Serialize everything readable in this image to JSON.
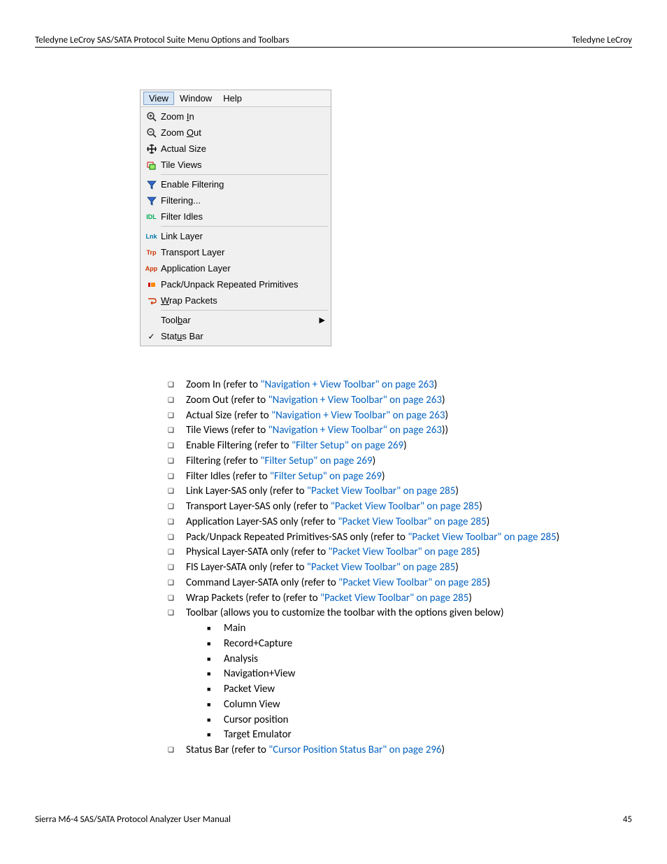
{
  "header": {
    "left": "Teledyne LeCroy SAS/SATA Protocol Suite Menu Options and Toolbars",
    "right": "Teledyne LeCroy"
  },
  "menubar": {
    "view": "View",
    "window": "Window",
    "help": "Help"
  },
  "menu": {
    "zoom_in": "Zoom In",
    "zoom_out": "Zoom Out",
    "actual_size": "Actual Size",
    "tile_views": "Tile Views",
    "enable_filtering": "Enable Filtering",
    "filtering": "Filtering...",
    "filter_idles": "Filter Idles",
    "link_layer": "Link Layer",
    "transport_layer": "Transport Layer",
    "application_layer": "Application Layer",
    "pack_unpack": "Pack/Unpack Repeated Primitives",
    "wrap_packets": "Wrap Packets",
    "toolbar": "Toolbar",
    "status_bar": "Status Bar",
    "icon_lnk": "Lnk",
    "icon_trp": "Trp",
    "icon_app": "App",
    "icon_idl": "IDL"
  },
  "list": [
    {
      "pre": "Zoom In (refer to ",
      "link": "\"Navigation + View Toolbar\" on page 263",
      "post": ")"
    },
    {
      "pre": "Zoom Out (refer to ",
      "link": "\"Navigation + View Toolbar\" on page 263",
      "post": ")"
    },
    {
      "pre": "Actual Size (refer to ",
      "link": "\"Navigation + View Toolbar\" on page 263",
      "post": ")"
    },
    {
      "pre": "Tile Views (refer to ",
      "link": "\"Navigation + View Toolbar\" on page 263",
      "post": "))"
    },
    {
      "pre": "Enable Filtering (refer to ",
      "link": "\"Filter Setup\" on page 269",
      "post": ")"
    },
    {
      "pre": "Filtering (refer to ",
      "link": "\"Filter Setup\" on page 269",
      "post": ")"
    },
    {
      "pre": "Filter Idles (refer to ",
      "link": "\"Filter Setup\" on page 269",
      "post": ")"
    },
    {
      "pre": "Link Layer-SAS only (refer to ",
      "link": "\"Packet View Toolbar\" on page 285",
      "post": ")"
    },
    {
      "pre": "Transport Layer-SAS only (refer to ",
      "link": "\"Packet View Toolbar\" on page 285",
      "post": ")"
    },
    {
      "pre": "Application Layer-SAS only (refer to ",
      "link": "\"Packet View Toolbar\" on page 285",
      "post": ")"
    },
    {
      "pre": "Pack/Unpack Repeated Primitives-SAS only (refer to ",
      "link": "\"Packet View Toolbar\" on page 285",
      "post": ")"
    },
    {
      "pre": "Physical Layer-SATA only (refer to ",
      "link": "\"Packet View Toolbar\" on page 285",
      "post": ")"
    },
    {
      "pre": "FIS Layer-SATA only (refer to ",
      "link": "\"Packet View Toolbar\" on page 285",
      "post": ")"
    },
    {
      "pre": "Command Layer-SATA only (refer to ",
      "link": "\"Packet View Toolbar\" on page 285",
      "post": ")"
    },
    {
      "pre": "Wrap Packets (refer to (refer to ",
      "link": "\"Packet View Toolbar\" on page 285",
      "post": ")"
    }
  ],
  "toolbar_line": "Toolbar (allows you to customize the toolbar with the options given below)",
  "toolbar_sub": [
    "Main",
    "Record+Capture",
    "Analysis",
    "Navigation+View",
    "Packet View",
    "Column View",
    "Cursor position",
    "Target Emulator"
  ],
  "statusbar_line": {
    "pre": "Status Bar (refer to ",
    "link": "\"Cursor Position Status Bar\" on page 296",
    "post": ")"
  },
  "footer": {
    "left": "Sierra M6-4 SAS/SATA Protocol Analyzer User Manual",
    "right": "45"
  }
}
